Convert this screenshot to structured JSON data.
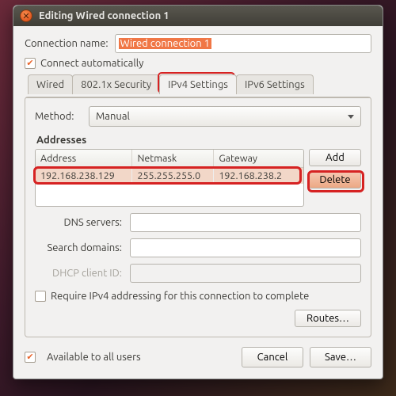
{
  "title": "Editing Wired connection 1",
  "connection_name_label": "Connection name:",
  "connection_name_value": "Wired connection 1",
  "connect_automatically_label": "Connect automatically",
  "connect_automatically_checked": true,
  "tabs": {
    "wired": "Wired",
    "security": "802.1x Security",
    "ipv4": "IPv4 Settings",
    "ipv6": "IPv6 Settings",
    "active": "ipv4"
  },
  "method_label": "Method:",
  "method_value": "Manual",
  "addresses_title": "Addresses",
  "addr_headers": {
    "address": "Address",
    "netmask": "Netmask",
    "gateway": "Gateway"
  },
  "addr_rows": [
    {
      "address": "192.168.238.129",
      "netmask": "255.255.255.0",
      "gateway": "192.168.238.2"
    }
  ],
  "buttons": {
    "add": "Add",
    "delete": "Delete",
    "routes": "Routes…",
    "cancel": "Cancel",
    "save": "Save…"
  },
  "dns_label": "DNS servers:",
  "dns_value": "",
  "search_label": "Search domains:",
  "search_value": "",
  "dhcp_label": "DHCP client ID:",
  "dhcp_value": "",
  "require_ipv4_label": "Require IPv4 addressing for this connection to complete",
  "require_ipv4_checked": false,
  "available_all_label": "Available to all users",
  "available_all_checked": true
}
